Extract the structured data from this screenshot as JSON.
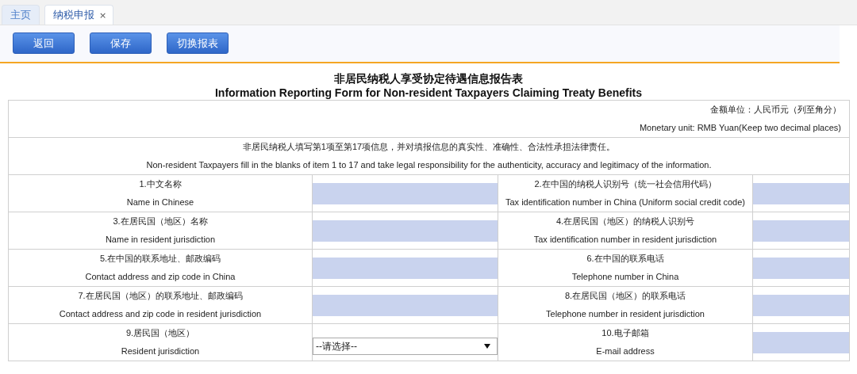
{
  "tabs": [
    {
      "label": "主页",
      "selected": false
    },
    {
      "label": "纳税申报",
      "selected": true,
      "close": "×"
    }
  ],
  "toolbar": {
    "buttons": [
      "返回",
      "保存",
      "切换报表"
    ]
  },
  "form": {
    "title_zh": "非居民纳税人享受协定待遇信息报告表",
    "title_en": "Information Reporting Form for Non-resident Taxpayers Claiming Treaty Benefits",
    "unit_zh": "金额单位：人民币元（列至角分）",
    "unit_en": "Monetary unit: RMB Yuan(Keep two decimal places)",
    "note_zh": "非居民纳税人填写第1项至第17项信息，并对填报信息的真实性、准确性、合法性承担法律责任。",
    "note_en": "Non-resident Taxpayers fill in the blanks of item 1 to 17 and take legal responsibility for the authenticity, accuracy and legitimacy of the information.",
    "rows": [
      [
        {
          "label_zh": "1.中文名称",
          "label_en": "Name in Chinese",
          "kind": "text"
        },
        {
          "label_zh": "2.在中国的纳税人识别号（统一社会信用代码）",
          "label_en": "Tax identification number in China (Uniform social credit code)",
          "kind": "text"
        }
      ],
      [
        {
          "label_zh": "3.在居民国（地区）名称",
          "label_en": "Name in resident jurisdiction",
          "kind": "text"
        },
        {
          "label_zh": "4.在居民国（地区）的纳税人识别号",
          "label_en": "Tax identification number in resident jurisdiction",
          "kind": "text"
        }
      ],
      [
        {
          "label_zh": "5.在中国的联系地址、邮政编码",
          "label_en": "Contact address and zip code in China",
          "kind": "text"
        },
        {
          "label_zh": "6.在中国的联系电话",
          "label_en": "Telephone number in China",
          "kind": "text"
        }
      ],
      [
        {
          "label_zh": "7.在居民国（地区）的联系地址、邮政编码",
          "label_en": "Contact address and zip code in resident jurisdiction",
          "kind": "text"
        },
        {
          "label_zh": "8.在居民国（地区）的联系电话",
          "label_en": "Telephone number in resident jurisdiction",
          "kind": "text"
        }
      ],
      [
        {
          "label_zh": "9.居民国（地区）",
          "label_en": "Resident jurisdiction",
          "kind": "select",
          "value": "--请选择--"
        },
        {
          "label_zh": "10.电子邮箱",
          "label_en": "E-mail address",
          "kind": "text"
        }
      ]
    ]
  }
}
